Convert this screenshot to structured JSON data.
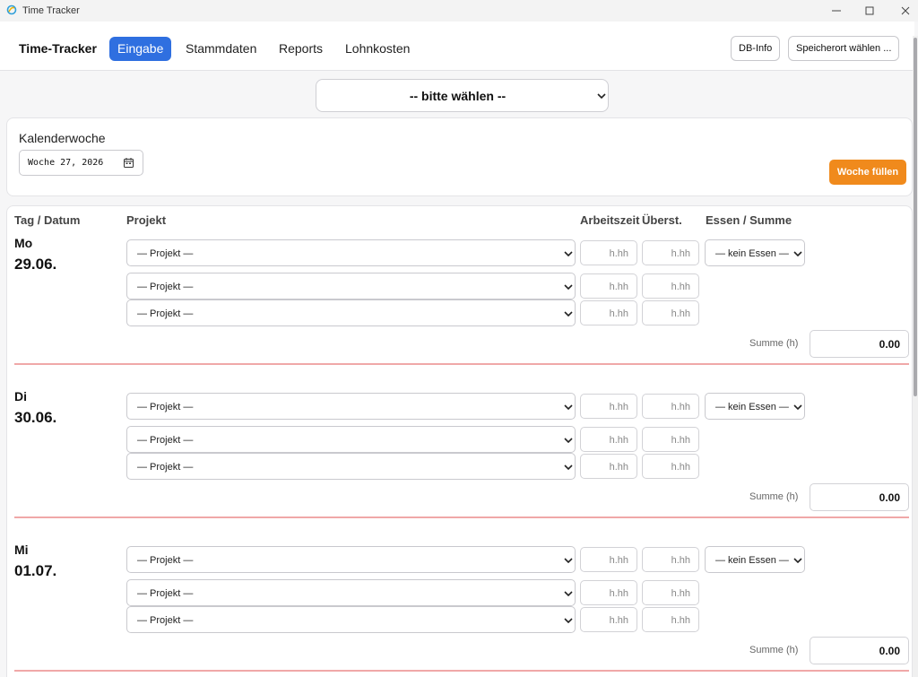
{
  "window": {
    "title": "Time Tracker"
  },
  "nav": {
    "brand": "Time-Tracker",
    "items": [
      {
        "label": "Eingabe",
        "active": true
      },
      {
        "label": "Stammdaten",
        "active": false
      },
      {
        "label": "Reports",
        "active": false
      },
      {
        "label": "Lohnkosten",
        "active": false
      }
    ],
    "db_info": "DB-Info",
    "storage": "Speicherort wählen ..."
  },
  "picker": {
    "selected": "-- bitte wählen --"
  },
  "week": {
    "label": "Kalenderwoche",
    "value": "Woche 27, 2026",
    "fill_button": "Woche füllen"
  },
  "table": {
    "headers": {
      "day": "Tag / Datum",
      "project": "Projekt",
      "worktime": "Arbeitszeit",
      "overtime": "Überst.",
      "meal": "Essen / Summe"
    },
    "project_placeholder": "— Projekt —",
    "hours_placeholder": "h.hh",
    "meal_default": "— kein Essen —",
    "sum_label": "Summe (h)",
    "days": [
      {
        "name": "Mo",
        "date": "29.06.",
        "sum": "0.00"
      },
      {
        "name": "Di",
        "date": "30.06.",
        "sum": "0.00"
      },
      {
        "name": "Mi",
        "date": "01.07.",
        "sum": "0.00"
      }
    ]
  },
  "colors": {
    "accent": "#2f6fe0",
    "fill_button": "#f08a1c",
    "divider": "#f0a8a8"
  }
}
